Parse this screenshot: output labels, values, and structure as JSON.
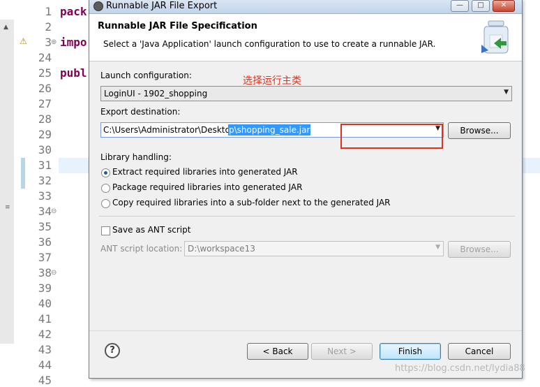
{
  "editor": {
    "line_numbers": [
      "1",
      "2",
      "3",
      "24",
      "25",
      "26",
      "27",
      "28",
      "29",
      "30",
      "31",
      "32",
      "33",
      "34",
      "35",
      "36",
      "37",
      "38",
      "39",
      "40",
      "41",
      "42",
      "43",
      "44",
      "45"
    ],
    "code_fragments": {
      "line1": "pack",
      "line3": "impo",
      "line25": "publ"
    }
  },
  "dialog": {
    "title": "Runnable JAR File Export",
    "titlebar_buttons": {
      "minimize": "—",
      "maximize": "□",
      "close": "✕"
    },
    "header": {
      "title": "Runnable JAR File Specification",
      "description": "Select a 'Java Application' launch configuration to use to create a runnable JAR."
    },
    "launch": {
      "label": "Launch configuration:",
      "value": "LoginUI - 1902_shopping"
    },
    "annotation": "选择运行主类",
    "export": {
      "label": "Export destination:",
      "value_unselected": "C:\\Users\\Administrator\\Deskto",
      "value_selected": "p\\shopping_sale.jar",
      "browse": "Browse..."
    },
    "library": {
      "label": "Library handling:",
      "options": [
        {
          "label": "Extract required libraries into generated JAR",
          "selected": true
        },
        {
          "label": "Package required libraries into generated JAR",
          "selected": false
        },
        {
          "label": "Copy required libraries into a sub-folder next to the generated JAR",
          "selected": false
        }
      ]
    },
    "ant": {
      "checkbox_label": "Save as ANT script",
      "checked": false,
      "location_label": "ANT script location:",
      "location_value": "D:\\workspace13",
      "browse": "Browse..."
    },
    "footer": {
      "back": "< Back",
      "next": "Next >",
      "finish": "Finish",
      "cancel": "Cancel"
    }
  },
  "watermark": "https://blog.csdn.net/lydia88",
  "colors": {
    "selection": "#3399ff",
    "annotation": "#e0311e",
    "keyword": "#7f0055"
  }
}
